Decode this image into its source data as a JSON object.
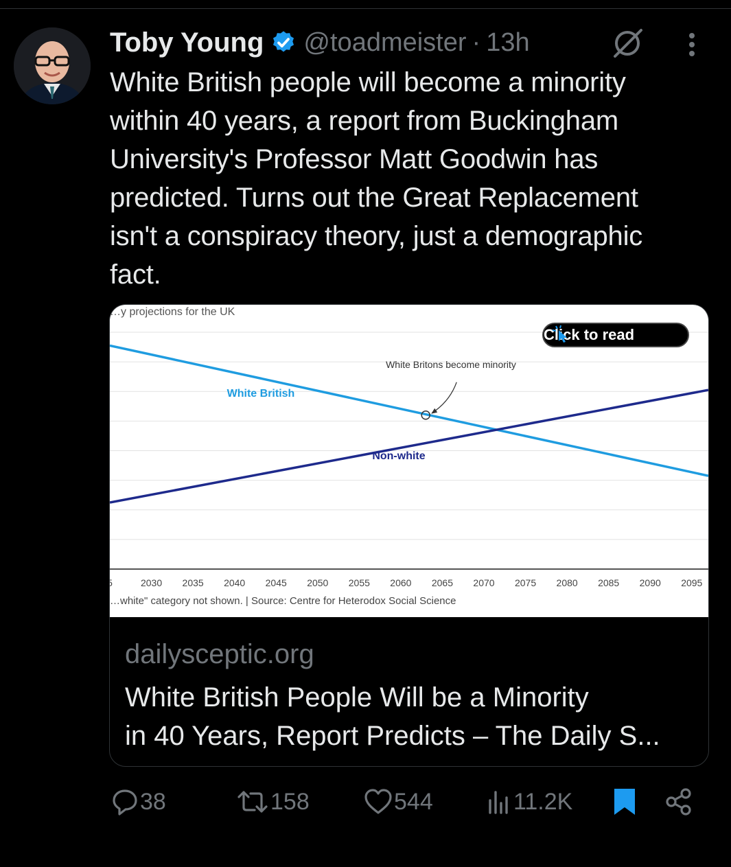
{
  "tweet": {
    "author": {
      "display_name": "Toby Young",
      "handle": "@toadmeister",
      "separator": "·",
      "time": "13h",
      "verified": true
    },
    "text": "White British people will become a minority\nwithin 40 years, a report from Buckingham\nUniversity's Professor Matt Goodwin has\npredicted. Turns out the Great Replacement\nisn't a conspiracy theory, just a demographic\nfact.",
    "icons": [
      "grok-icon",
      "more-icon"
    ]
  },
  "card": {
    "domain": "dailysceptic.org",
    "title_lines": [
      "White British People Will be a Minority",
      "in 40 Years, Report Predicts – The Daily S..."
    ],
    "click_to_read": "Click to read",
    "colors": {
      "white_british": "#1f9ce0",
      "non_white": "#1e2a8c"
    }
  },
  "chart_data": {
    "type": "line",
    "title": "…y projections for the UK",
    "annotation": "White Britons become minority",
    "source_note": "…white\" category not shown. | Source: Centre for Heterodox Social Science",
    "x_ticks": [
      "5",
      "2030",
      "2035",
      "2040",
      "2045",
      "2050",
      "2055",
      "2060",
      "2065",
      "2070",
      "2075",
      "2080",
      "2085",
      "2090",
      "2095"
    ],
    "series": [
      {
        "name": "White British",
        "x": [
          2025,
          2097
        ],
        "y": [
          0.755,
          0.315
        ]
      },
      {
        "name": "Non-white",
        "x": [
          2025,
          2097
        ],
        "y": [
          0.225,
          0.605
        ]
      }
    ],
    "annotation_point": {
      "x": 2063,
      "y": 0.52
    },
    "ylim": [
      0,
      0.8
    ],
    "grid": true
  },
  "actions": {
    "replies": "38",
    "reposts": "158",
    "likes": "544",
    "views": "11.2K"
  }
}
